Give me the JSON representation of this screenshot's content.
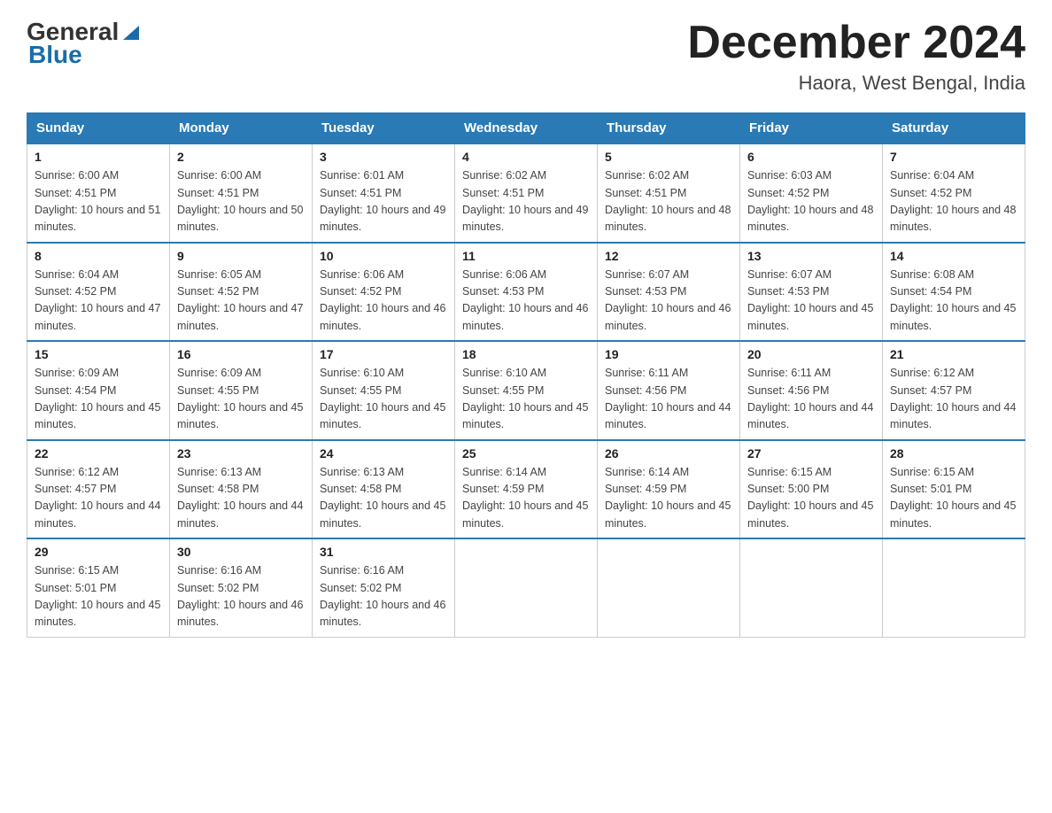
{
  "logo": {
    "general": "General",
    "blue": "Blue"
  },
  "title": "December 2024",
  "subtitle": "Haora, West Bengal, India",
  "headers": [
    "Sunday",
    "Monday",
    "Tuesday",
    "Wednesday",
    "Thursday",
    "Friday",
    "Saturday"
  ],
  "weeks": [
    [
      {
        "day": "1",
        "sunrise": "Sunrise: 6:00 AM",
        "sunset": "Sunset: 4:51 PM",
        "daylight": "Daylight: 10 hours and 51 minutes."
      },
      {
        "day": "2",
        "sunrise": "Sunrise: 6:00 AM",
        "sunset": "Sunset: 4:51 PM",
        "daylight": "Daylight: 10 hours and 50 minutes."
      },
      {
        "day": "3",
        "sunrise": "Sunrise: 6:01 AM",
        "sunset": "Sunset: 4:51 PM",
        "daylight": "Daylight: 10 hours and 49 minutes."
      },
      {
        "day": "4",
        "sunrise": "Sunrise: 6:02 AM",
        "sunset": "Sunset: 4:51 PM",
        "daylight": "Daylight: 10 hours and 49 minutes."
      },
      {
        "day": "5",
        "sunrise": "Sunrise: 6:02 AM",
        "sunset": "Sunset: 4:51 PM",
        "daylight": "Daylight: 10 hours and 48 minutes."
      },
      {
        "day": "6",
        "sunrise": "Sunrise: 6:03 AM",
        "sunset": "Sunset: 4:52 PM",
        "daylight": "Daylight: 10 hours and 48 minutes."
      },
      {
        "day": "7",
        "sunrise": "Sunrise: 6:04 AM",
        "sunset": "Sunset: 4:52 PM",
        "daylight": "Daylight: 10 hours and 48 minutes."
      }
    ],
    [
      {
        "day": "8",
        "sunrise": "Sunrise: 6:04 AM",
        "sunset": "Sunset: 4:52 PM",
        "daylight": "Daylight: 10 hours and 47 minutes."
      },
      {
        "day": "9",
        "sunrise": "Sunrise: 6:05 AM",
        "sunset": "Sunset: 4:52 PM",
        "daylight": "Daylight: 10 hours and 47 minutes."
      },
      {
        "day": "10",
        "sunrise": "Sunrise: 6:06 AM",
        "sunset": "Sunset: 4:52 PM",
        "daylight": "Daylight: 10 hours and 46 minutes."
      },
      {
        "day": "11",
        "sunrise": "Sunrise: 6:06 AM",
        "sunset": "Sunset: 4:53 PM",
        "daylight": "Daylight: 10 hours and 46 minutes."
      },
      {
        "day": "12",
        "sunrise": "Sunrise: 6:07 AM",
        "sunset": "Sunset: 4:53 PM",
        "daylight": "Daylight: 10 hours and 46 minutes."
      },
      {
        "day": "13",
        "sunrise": "Sunrise: 6:07 AM",
        "sunset": "Sunset: 4:53 PM",
        "daylight": "Daylight: 10 hours and 45 minutes."
      },
      {
        "day": "14",
        "sunrise": "Sunrise: 6:08 AM",
        "sunset": "Sunset: 4:54 PM",
        "daylight": "Daylight: 10 hours and 45 minutes."
      }
    ],
    [
      {
        "day": "15",
        "sunrise": "Sunrise: 6:09 AM",
        "sunset": "Sunset: 4:54 PM",
        "daylight": "Daylight: 10 hours and 45 minutes."
      },
      {
        "day": "16",
        "sunrise": "Sunrise: 6:09 AM",
        "sunset": "Sunset: 4:55 PM",
        "daylight": "Daylight: 10 hours and 45 minutes."
      },
      {
        "day": "17",
        "sunrise": "Sunrise: 6:10 AM",
        "sunset": "Sunset: 4:55 PM",
        "daylight": "Daylight: 10 hours and 45 minutes."
      },
      {
        "day": "18",
        "sunrise": "Sunrise: 6:10 AM",
        "sunset": "Sunset: 4:55 PM",
        "daylight": "Daylight: 10 hours and 45 minutes."
      },
      {
        "day": "19",
        "sunrise": "Sunrise: 6:11 AM",
        "sunset": "Sunset: 4:56 PM",
        "daylight": "Daylight: 10 hours and 44 minutes."
      },
      {
        "day": "20",
        "sunrise": "Sunrise: 6:11 AM",
        "sunset": "Sunset: 4:56 PM",
        "daylight": "Daylight: 10 hours and 44 minutes."
      },
      {
        "day": "21",
        "sunrise": "Sunrise: 6:12 AM",
        "sunset": "Sunset: 4:57 PM",
        "daylight": "Daylight: 10 hours and 44 minutes."
      }
    ],
    [
      {
        "day": "22",
        "sunrise": "Sunrise: 6:12 AM",
        "sunset": "Sunset: 4:57 PM",
        "daylight": "Daylight: 10 hours and 44 minutes."
      },
      {
        "day": "23",
        "sunrise": "Sunrise: 6:13 AM",
        "sunset": "Sunset: 4:58 PM",
        "daylight": "Daylight: 10 hours and 44 minutes."
      },
      {
        "day": "24",
        "sunrise": "Sunrise: 6:13 AM",
        "sunset": "Sunset: 4:58 PM",
        "daylight": "Daylight: 10 hours and 45 minutes."
      },
      {
        "day": "25",
        "sunrise": "Sunrise: 6:14 AM",
        "sunset": "Sunset: 4:59 PM",
        "daylight": "Daylight: 10 hours and 45 minutes."
      },
      {
        "day": "26",
        "sunrise": "Sunrise: 6:14 AM",
        "sunset": "Sunset: 4:59 PM",
        "daylight": "Daylight: 10 hours and 45 minutes."
      },
      {
        "day": "27",
        "sunrise": "Sunrise: 6:15 AM",
        "sunset": "Sunset: 5:00 PM",
        "daylight": "Daylight: 10 hours and 45 minutes."
      },
      {
        "day": "28",
        "sunrise": "Sunrise: 6:15 AM",
        "sunset": "Sunset: 5:01 PM",
        "daylight": "Daylight: 10 hours and 45 minutes."
      }
    ],
    [
      {
        "day": "29",
        "sunrise": "Sunrise: 6:15 AM",
        "sunset": "Sunset: 5:01 PM",
        "daylight": "Daylight: 10 hours and 45 minutes."
      },
      {
        "day": "30",
        "sunrise": "Sunrise: 6:16 AM",
        "sunset": "Sunset: 5:02 PM",
        "daylight": "Daylight: 10 hours and 46 minutes."
      },
      {
        "day": "31",
        "sunrise": "Sunrise: 6:16 AM",
        "sunset": "Sunset: 5:02 PM",
        "daylight": "Daylight: 10 hours and 46 minutes."
      },
      null,
      null,
      null,
      null
    ]
  ]
}
